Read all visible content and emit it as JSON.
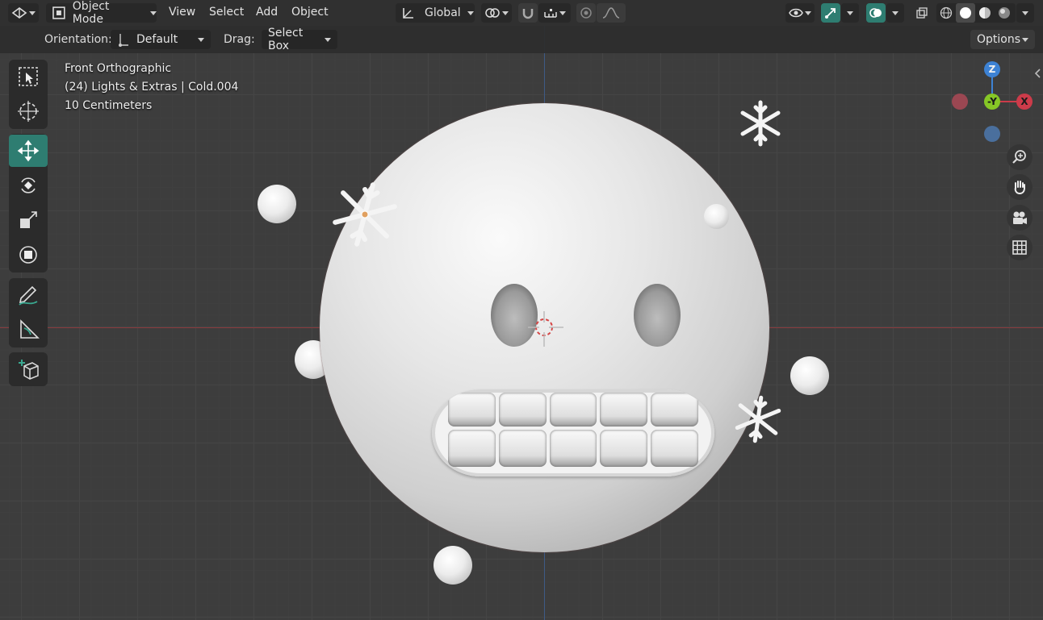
{
  "header": {
    "mode_label": "Object Mode",
    "menus": [
      "View",
      "Select",
      "Add",
      "Object"
    ],
    "transform_orientation": "Global",
    "options_label": "Options"
  },
  "tool_settings": {
    "orientation_label": "Orientation:",
    "orientation_value": "Default",
    "drag_label": "Drag:",
    "drag_value": "Select Box"
  },
  "viewport_info": {
    "view_name": "Front Orthographic",
    "collection_object": "(24) Lights & Extras | Cold.004",
    "scale": "10 Centimeters"
  },
  "gizmo": {
    "z_label": "Z",
    "y_label": "-Y",
    "x_label": "X"
  },
  "colors": {
    "accent": "#2e7d71",
    "x_axis": "#cc3b4a",
    "y_axis": "#86c726",
    "z_axis": "#3d82d4",
    "header_bg": "#303030",
    "viewport_bg": "#3d3d3d"
  },
  "icons": {
    "editor_type": "editor-type-icon",
    "tools": [
      "select-box-icon",
      "cursor-icon",
      "move-icon",
      "rotate-icon",
      "scale-icon",
      "transform-icon",
      "annotate-icon",
      "measure-icon",
      "add-cube-icon"
    ],
    "nav": [
      "zoom-icon",
      "hand-pan-icon",
      "camera-icon",
      "grid-view-icon"
    ]
  }
}
